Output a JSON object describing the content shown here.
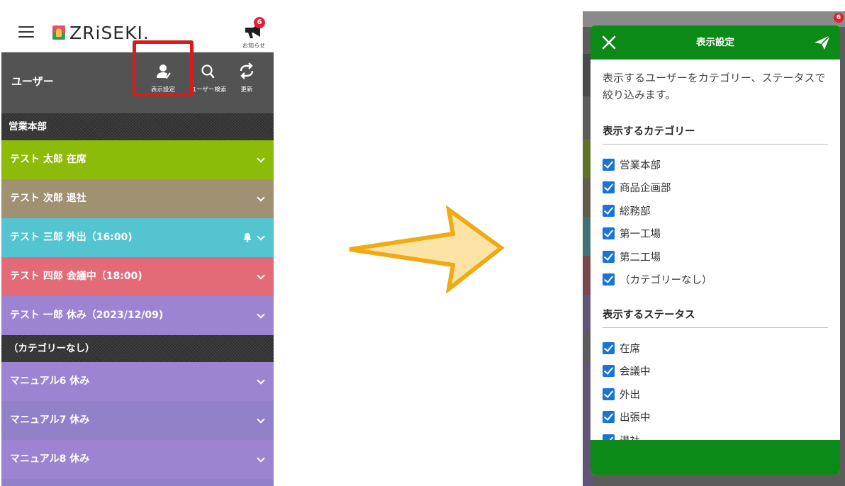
{
  "left": {
    "logo_text": "ZRiSEKI.",
    "notice": {
      "badge": "6",
      "label": "お知らせ"
    },
    "toolbar": {
      "title": "ユーザー",
      "display_settings_label": "表示設定",
      "user_search_label": "ユーザー検索",
      "refresh_label": "更新"
    },
    "categories": [
      {
        "name": "営業本部",
        "users": [
          {
            "text": "テスト  太郎  在席",
            "color": "#8dbb0a"
          },
          {
            "text": "テスト  次郎  退社",
            "color": "#a09173"
          },
          {
            "text": "テスト  三郎  外出（16:00)",
            "color": "#54c4d0",
            "bell": true
          },
          {
            "text": "テスト  四郎  会議中（18:00)",
            "color": "#e36b78"
          },
          {
            "text": "テスト  一郎  休み（2023/12/09)",
            "color": "#9d84d2"
          }
        ]
      },
      {
        "name": "（カテゴリーなし）",
        "users": [
          {
            "text": "マニュアル6  休み",
            "color": "#9d84d2"
          },
          {
            "text": "マニュアル7  休み",
            "color": "#9181c9"
          },
          {
            "text": "マニュアル8  休み",
            "color": "#9d84d2"
          }
        ]
      }
    ]
  },
  "right": {
    "badge": "6",
    "modal": {
      "title": "表示設定",
      "description": "表示するユーザーをカテゴリー、ステータスで絞り込みます。",
      "category_section_title": "表示するカテゴリー",
      "categories": [
        "営業本部",
        "商品企画部",
        "総務部",
        "第一工場",
        "第二工場",
        "（カテゴリーなし）"
      ],
      "status_section_title": "表示するステータス",
      "statuses": [
        "在席",
        "会議中",
        "外出",
        "出張中",
        "退社"
      ]
    }
  },
  "colors": {
    "accent_green": "#0c8a17",
    "highlight_red": "#d61c1c",
    "arrow_fill": "#fde4a6",
    "arrow_stroke": "#f0aa14",
    "checkbox_blue": "#1a73d9"
  }
}
